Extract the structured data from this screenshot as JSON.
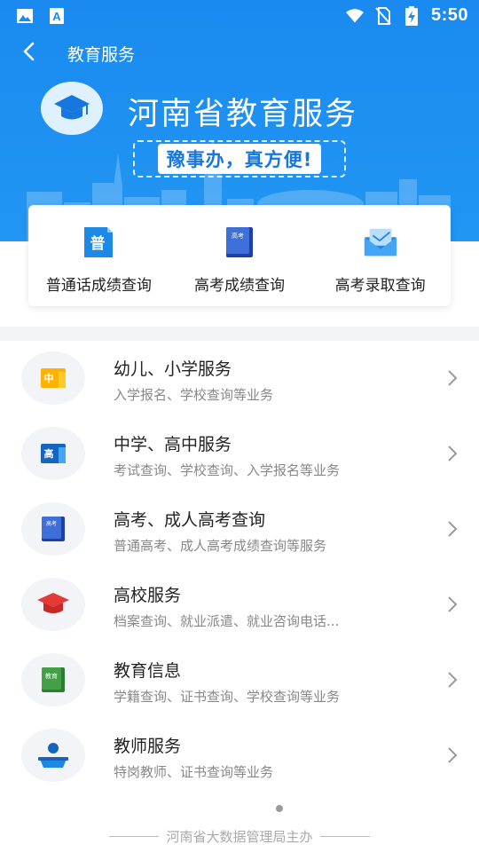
{
  "status_bar": {
    "time": "5:50",
    "icons": [
      "image-icon",
      "font-a-icon",
      "wifi-icon",
      "no-sim-icon",
      "battery-charging-icon"
    ]
  },
  "nav": {
    "title": "教育服务",
    "back_icon": "back-arrow-icon"
  },
  "banner": {
    "title": "河南省教育服务",
    "slogan": "豫事办，真方便!"
  },
  "quick_actions": [
    {
      "label": "普通话成绩查询",
      "icon": "mandarin-book-icon",
      "icon_text": "普"
    },
    {
      "label": "高考成绩查询",
      "icon": "gaokao-book-icon",
      "icon_text": "高考"
    },
    {
      "label": "高考录取查询",
      "icon": "admission-envelope-icon"
    }
  ],
  "services": [
    {
      "title": "幼儿、小学服务",
      "subtitle": "入学报名、学校查询等业务",
      "icon": "primary-school-icon",
      "icon_text": "中"
    },
    {
      "title": "中学、高中服务",
      "subtitle": "考试查询、学校查询、入学报名等业务",
      "icon": "high-school-icon",
      "icon_text": "高"
    },
    {
      "title": "高考、成人高考查询",
      "subtitle": "普通高考、成人高考成绩查询等服务",
      "icon": "gaokao-icon",
      "icon_text": "高考"
    },
    {
      "title": "高校服务",
      "subtitle": "档案查询、就业派遣、就业咨询电话...",
      "icon": "graduation-cap-icon"
    },
    {
      "title": "教育信息",
      "subtitle": "学籍查询、证书查询、学校查询等业务",
      "icon": "education-info-icon",
      "icon_text": "教育"
    },
    {
      "title": "教师服务",
      "subtitle": "特岗教师、证书查询等业务",
      "icon": "teacher-icon"
    }
  ],
  "footer": {
    "text": "河南省大数据管理局主办"
  },
  "colors": {
    "primary": "#2196f3",
    "slogan": "#1677e0",
    "text": "#222222",
    "subtext": "#888888"
  }
}
